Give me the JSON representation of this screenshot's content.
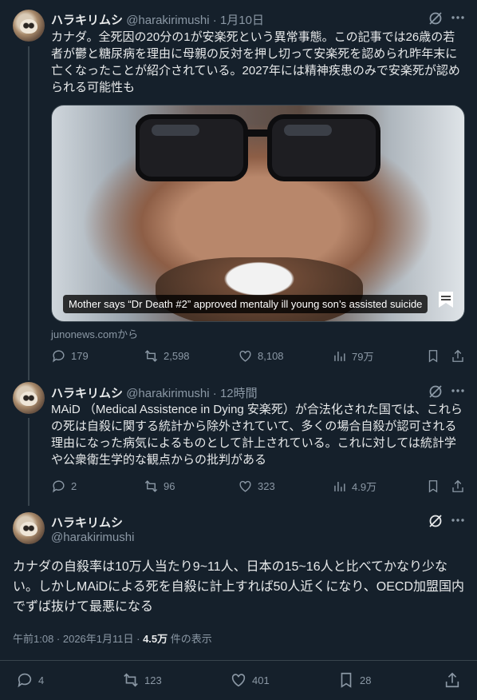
{
  "tweets": [
    {
      "name": "ハラキリムシ",
      "handle": "@harakirimushi",
      "dot": "·",
      "time": "1月10日",
      "text": "カナダ。全死因の20分の1が安楽死という異常事態。この記事では26歳の若者が鬱と糖尿病を理由に母親の反対を押し切って安楽死を認められ昨年末に亡くなったことが紹介されている。2027年には精神疾患のみで安楽死が認められる可能性も",
      "media_caption": "Mother says “Dr Death #2” approved mentally ill young son’s assisted suicide",
      "source": "junonews.comから",
      "stats": {
        "replies": "179",
        "retweets": "2,598",
        "likes": "8,108",
        "views": "79万"
      }
    },
    {
      "name": "ハラキリムシ",
      "handle": "@harakirimushi",
      "dot": "·",
      "time": "12時間",
      "text": "MAiD （Medical Assistence in Dying 安楽死）が合法化された国では、これらの死は自殺に関する統計から除外されていて、多くの場合自殺が認可される理由になった病気によるものとして計上されている。これに対しては統計学や公衆衛生学的な観点からの批判がある",
      "stats": {
        "replies": "2",
        "retweets": "96",
        "likes": "323",
        "views": "4.9万"
      }
    }
  ],
  "main_tweet": {
    "name": "ハラキリムシ",
    "handle": "@harakirimushi",
    "text": "カナダの自殺率は10万人当たり9~11人、日本の15~16人と比べてかなり少ない。しかしMAiDによる死を自殺に計上すれば50人近くになり、OECD加盟国内でずば抜けて最悪になる",
    "timestamp": "午前1:08 · 2026年1月11日 · ",
    "views_count": "4.5万",
    "views_label": " 件の表示",
    "stats": {
      "replies": "4",
      "retweets": "123",
      "likes": "401",
      "bookmarks": "28"
    }
  },
  "icons": {
    "more": "more-icon",
    "grok": "grok-icon",
    "reply": "reply-icon",
    "retweet": "retweet-icon",
    "like": "heart-icon",
    "views": "views-icon",
    "bookmark": "bookmark-icon",
    "share": "share-icon"
  },
  "colors": {
    "background": "#15202b",
    "muted": "#8b98a5",
    "text": "#e7e9ea",
    "divider": "#38444d"
  }
}
